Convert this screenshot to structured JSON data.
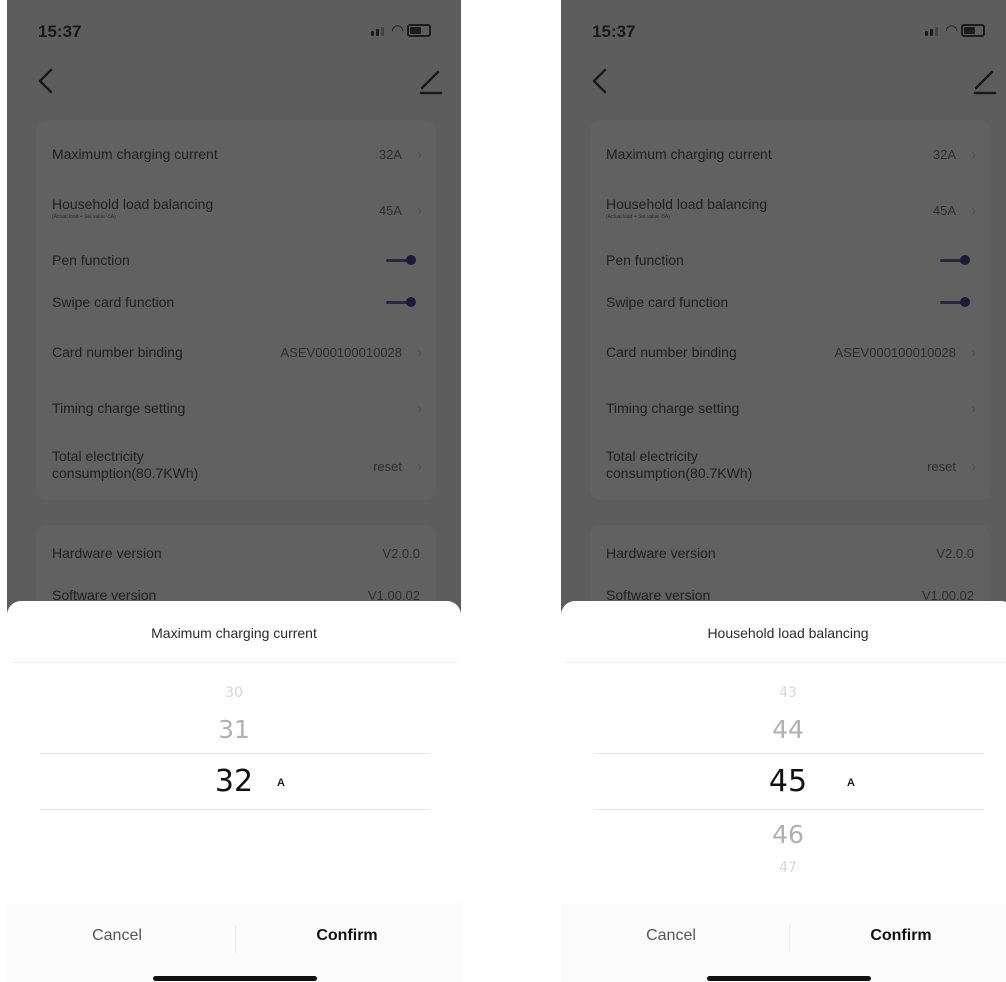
{
  "screens": [
    {
      "status_time": "15:37",
      "settings": {
        "max_current_label": "Maximum charging current",
        "max_current_value": "32A",
        "load_balancing_label": "Household load balancing",
        "load_balancing_sub": "(Actual load + Set value -5A)",
        "load_balancing_value": "45A",
        "pen_label": "Pen function",
        "swipe_label": "Swipe card function",
        "card_binding_label": "Card number binding",
        "card_binding_value": "ASEV000100010028",
        "timing_label": "Timing charge setting",
        "total_line1": "Total electricity",
        "total_line2": "consumption(80.7KWh)",
        "reset_value": "reset",
        "hardware_label": "Hardware version",
        "hardware_value": "V2.0.0",
        "software_label": "Software version",
        "software_value": "V1.00.02"
      },
      "sheet": {
        "title": "Maximum charging current",
        "picker": {
          "above_far": "30",
          "above": "31",
          "selected": "32",
          "below": "",
          "below_far": "",
          "unit": "A"
        },
        "cancel_label": "Cancel",
        "confirm_label": "Confirm"
      }
    },
    {
      "status_time": "15:37",
      "settings": {
        "max_current_label": "Maximum charging current",
        "max_current_value": "32A",
        "load_balancing_label": "Household load balancing",
        "load_balancing_sub": "(Actual load + Set value -5A)",
        "load_balancing_value": "45A",
        "pen_label": "Pen function",
        "swipe_label": "Swipe card function",
        "card_binding_label": "Card number binding",
        "card_binding_value": "ASEV000100010028",
        "timing_label": "Timing charge setting",
        "total_line1": "Total electricity",
        "total_line2": "consumption(80.7KWh)",
        "reset_value": "reset",
        "hardware_label": "Hardware version",
        "hardware_value": "V2.0.0",
        "software_label": "Software version",
        "software_value": "V1.00.02"
      },
      "sheet": {
        "title": "Household load balancing",
        "picker": {
          "above_far": "43",
          "above": "44",
          "selected": "45",
          "below": "46",
          "below_far": "47",
          "unit": "A"
        },
        "cancel_label": "Cancel",
        "confirm_label": "Confirm"
      }
    }
  ],
  "icons": {
    "back": "chevron-left-icon",
    "edit": "pencil-icon",
    "wifi": "wifi-icon",
    "battery": "battery-icon",
    "signal": "signal-icon"
  },
  "colors": {
    "overlay_bg": "#5d5d5d",
    "card_bg": "#616161",
    "toggle_on": "#1c1c3a",
    "sheet_bg": "#ffffff"
  }
}
